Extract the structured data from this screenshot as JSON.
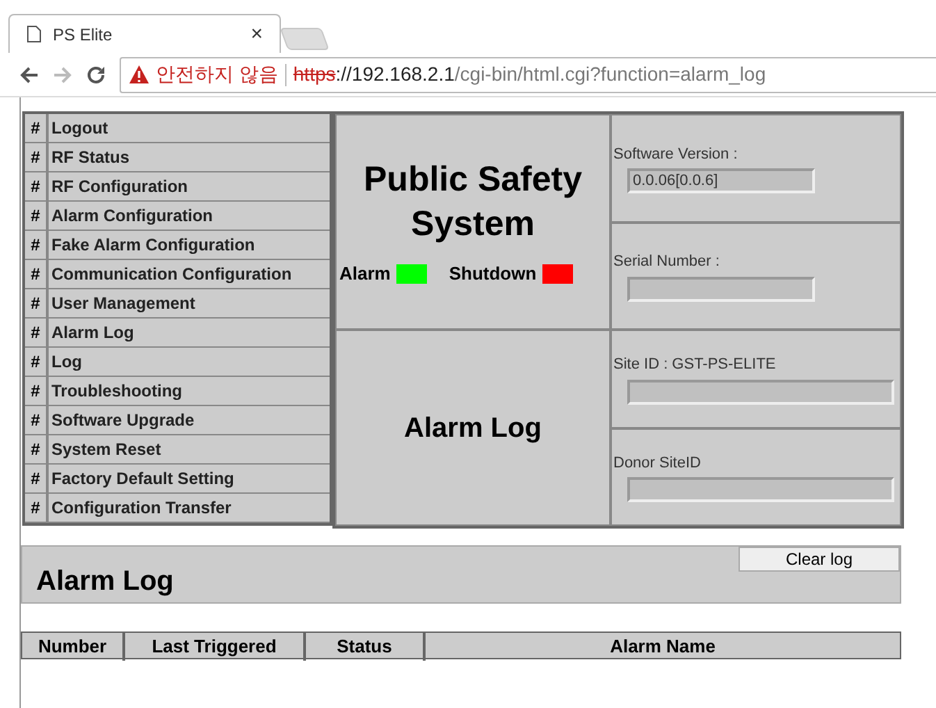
{
  "browser": {
    "tab_title": "PS Elite",
    "tab_close": "×",
    "security_warning": "안전하지 않음",
    "url_scheme": "https",
    "url_host": "://192.168.2.1",
    "url_path": "/cgi-bin/html.cgi?function=alarm_log"
  },
  "menu": [
    {
      "mark": "#",
      "label": "Logout"
    },
    {
      "mark": "#",
      "label": "RF Status"
    },
    {
      "mark": "#",
      "label": "RF Configuration"
    },
    {
      "mark": "#",
      "label": "Alarm Configuration"
    },
    {
      "mark": "#",
      "label": "Fake Alarm Configuration"
    },
    {
      "mark": "#",
      "label": "Communication Configuration"
    },
    {
      "mark": "#",
      "label": "User Management"
    },
    {
      "mark": "#",
      "label": "Alarm Log"
    },
    {
      "mark": "#",
      "label": "Log"
    },
    {
      "mark": "#",
      "label": "Troubleshooting"
    },
    {
      "mark": "#",
      "label": "Software Upgrade"
    },
    {
      "mark": "#",
      "label": "System Reset"
    },
    {
      "mark": "#",
      "label": "Factory Default Setting"
    },
    {
      "mark": "#",
      "label": "Configuration Transfer"
    }
  ],
  "header": {
    "title": "Public Safety System",
    "indicators": [
      {
        "label": "Alarm",
        "color": "#00ff00"
      },
      {
        "label": "Shutdown",
        "color": "#ff0000"
      }
    ],
    "page_name": "Alarm Log"
  },
  "info": [
    {
      "label": "Software Version :",
      "value": "0.0.06[0.0.6]",
      "wide": false
    },
    {
      "label": "Serial Number :",
      "wide": false
    },
    {
      "label": "Site ID : GST-PS-ELITE",
      "wide": true
    },
    {
      "label": "Donor SiteID",
      "wide": true
    }
  ],
  "alarm_log": {
    "title": "Alarm Log",
    "clear_button": "Clear log",
    "columns": [
      "Number",
      "Last Triggered",
      "Status",
      "Alarm Name"
    ]
  }
}
